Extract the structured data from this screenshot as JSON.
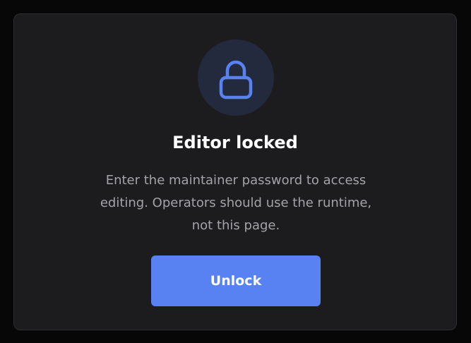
{
  "dialog": {
    "icon": "lock-icon",
    "title": "Editor locked",
    "message": "Enter the maintainer password to access editing. Operators should use the runtime, not this page.",
    "unlock_label": "Unlock"
  },
  "colors": {
    "accent": "#5881f2",
    "card_background": "#1c1c1e",
    "icon_badge": "#232a3d",
    "page_background": "#070708"
  }
}
